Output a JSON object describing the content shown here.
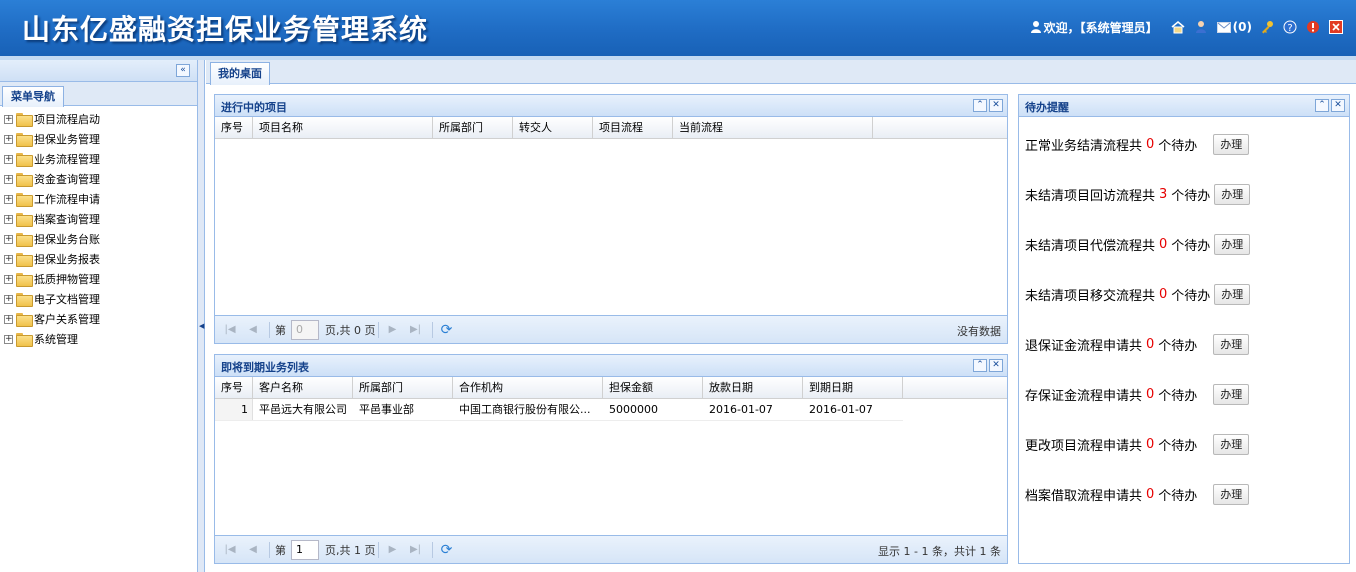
{
  "header": {
    "title": "山东亿盛融资担保业务管理系统",
    "welcome": "欢迎，【系统管理员】",
    "mail_count": "(0)"
  },
  "left": {
    "tab_label": "菜单导航",
    "items": [
      {
        "label": "项目流程启动"
      },
      {
        "label": "担保业务管理"
      },
      {
        "label": "业务流程管理"
      },
      {
        "label": "资金查询管理"
      },
      {
        "label": "工作流程申请"
      },
      {
        "label": "档案查询管理"
      },
      {
        "label": "担保业务台账"
      },
      {
        "label": "担保业务报表"
      },
      {
        "label": "抵质押物管理"
      },
      {
        "label": "电子文档管理"
      },
      {
        "label": "客户关系管理"
      },
      {
        "label": "系统管理"
      }
    ]
  },
  "main": {
    "tab_label": "我的桌面"
  },
  "projects_panel": {
    "title": "进行中的项目",
    "columns": [
      "序号",
      "项目名称",
      "所属部门",
      "转交人",
      "项目流程",
      "当前流程"
    ],
    "pager": {
      "page_prefix": "第",
      "page_value": "0",
      "page_suffix": "页,共 0 页",
      "info": "没有数据"
    }
  },
  "expiring_panel": {
    "title": "即将到期业务列表",
    "columns": [
      "序号",
      "客户名称",
      "所属部门",
      "合作机构",
      "担保金额",
      "放款日期",
      "到期日期"
    ],
    "rows": [
      {
        "num": "1",
        "customer": "平邑远大有限公司",
        "dept": "平邑事业部",
        "org": "中国工商银行股份有限公...",
        "amount": "5000000",
        "loan_date": "2016-01-07",
        "due_date": "2016-01-07"
      }
    ],
    "pager": {
      "page_prefix": "第",
      "page_value": "1",
      "page_suffix": "页,共 1 页",
      "info": "显示 1 - 1 条，共计 1 条"
    }
  },
  "todo_panel": {
    "title": "待办提醒",
    "button_label": "办理",
    "unit": "个待办",
    "items": [
      {
        "label": "正常业务结清流程共",
        "count": "0"
      },
      {
        "label": "未结清项目回访流程共",
        "count": "3"
      },
      {
        "label": "未结清项目代偿流程共",
        "count": "0"
      },
      {
        "label": "未结清项目移交流程共",
        "count": "0"
      },
      {
        "label": "退保证金流程申请共",
        "count": "0"
      },
      {
        "label": "存保证金流程申请共",
        "count": "0"
      },
      {
        "label": "更改项目流程申请共",
        "count": "0"
      },
      {
        "label": "档案借取流程申请共",
        "count": "0"
      }
    ]
  },
  "colors": {
    "header_blue": "#1f6cc4",
    "panel_title": "#15428b",
    "count_red": "#e60000"
  }
}
